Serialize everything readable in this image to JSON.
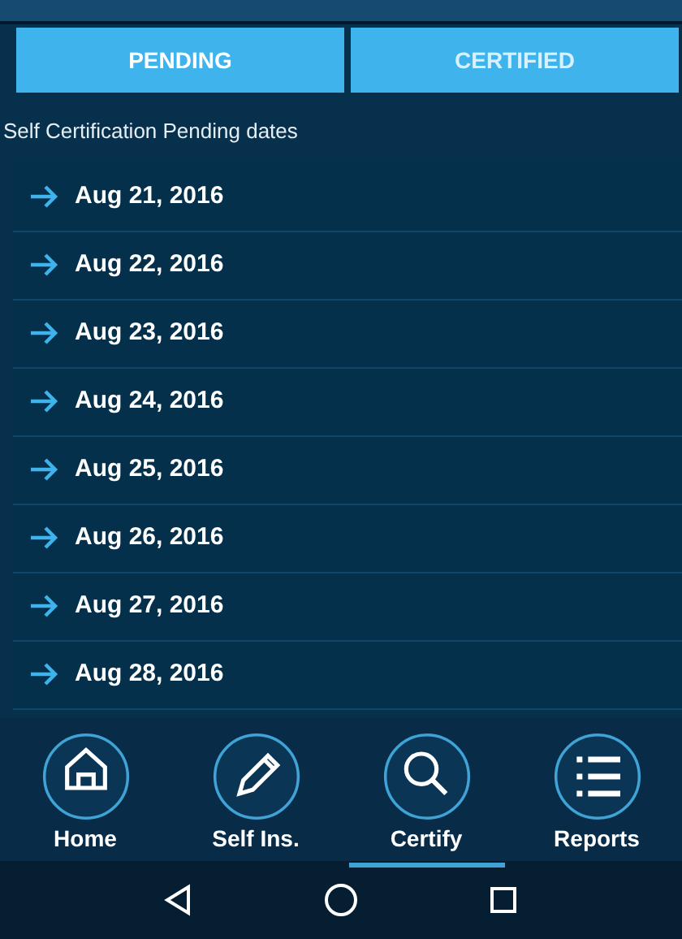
{
  "tabs": [
    {
      "label": "PENDING",
      "selected": true
    },
    {
      "label": "CERTIFIED",
      "selected": false
    }
  ],
  "heading": "Self Certification Pending dates",
  "dates": [
    "Aug 21, 2016",
    "Aug 22, 2016",
    "Aug 23, 2016",
    "Aug 24, 2016",
    "Aug 25, 2016",
    "Aug 26, 2016",
    "Aug 27, 2016",
    "Aug 28, 2016"
  ],
  "bottom_nav": [
    {
      "label": "Home",
      "kind": "home",
      "selected": false
    },
    {
      "label": "Self Ins.",
      "kind": "pencil",
      "selected": false
    },
    {
      "label": "Certify",
      "kind": "search",
      "selected": true
    },
    {
      "label": "Reports",
      "kind": "list",
      "selected": false
    }
  ]
}
